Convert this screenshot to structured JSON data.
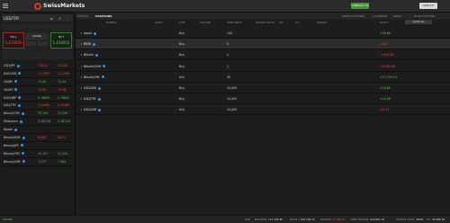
{
  "brand": {
    "name": "SwissMarkets"
  },
  "header": {
    "contact_label": "CONTACT US",
    "deposit_label": "DEPOSIT"
  },
  "symbol": {
    "name": "USD/TRY",
    "icons": "⇄ ↗ ⋮"
  },
  "trade": {
    "sell_label": "SELL",
    "sell_price": "5.434689",
    "buy_label": "BUY",
    "buy_price": "5.434952",
    "quantity": "10,000"
  },
  "watchlist": [
    {
      "name": "USD/JPY",
      "bid": "110.61",
      "ask": "110.62",
      "dir": "dn"
    },
    {
      "name": "EUR/USD",
      "bid": "1.17797",
      "ask": "1.17799",
      "dir": "dn"
    },
    {
      "name": "Oil/BR",
      "bid": "72.40",
      "ask": "72.44",
      "dir": "up"
    },
    {
      "name": "Oil/WT",
      "bid": "70.55",
      "ask": "70.58",
      "dir": "dn"
    },
    {
      "name": "EUR/GBP",
      "bid": "0.76849",
      "ask": "0.76852",
      "dir": "up"
    },
    {
      "name": "USD/TRY",
      "bid": "5.43469",
      "ask": "5.43495",
      "dir": "dn"
    },
    {
      "name": "Bitcoin/TRY",
      "bid": "47,195",
      "ask": "47,235",
      "dir": "up"
    },
    {
      "name": "Ethereum",
      "bid": "3,163.58",
      "ask": "3,167.93",
      "dir": "up"
    },
    {
      "name": "Ripple",
      "bid": "",
      "ask": "",
      "dir": "none"
    },
    {
      "name": "Bitcoin/EUR",
      "bid": "8,462",
      "ask": "8,472",
      "dir": "dn"
    },
    {
      "name": "Bitcoin/JPY",
      "bid": "",
      "ask": "",
      "dir": "none"
    },
    {
      "name": "Bitcoin/TRY",
      "bid": "47,191",
      "ask": "47,231",
      "dir": "up"
    },
    {
      "name": "Bitcoin/GBP",
      "bid": "7,577",
      "ask": "7,583",
      "dir": "up"
    }
  ],
  "tabs": [
    "CHARTS",
    "POSITIONS",
    "OPEN POSITIONS",
    "CALENDAR",
    "NEWS",
    "NOTIFICATIONS"
  ],
  "columns": [
    "SYMBOL",
    "ASSET",
    "TYPE",
    "VOLUME",
    "OPEN PRICE",
    "MARKET PRICE",
    "T/P",
    "S/L",
    "MARGIN",
    "PROFIT"
  ],
  "close_all_label": "CLOSE ALL",
  "positions": [
    {
      "instrument": "Apple",
      "direction": "Buy",
      "volume": "100",
      "profit": "+56.64",
      "pcls": "up",
      "sel": false
    },
    {
      "instrument": "BMW",
      "direction": "Buy",
      "volume": "5",
      "profit": "-2.01",
      "pcls": "dn",
      "sel": true
    },
    {
      "instrument": "Bitcoin",
      "direction": "Buy",
      "volume": "1",
      "profit": "-1,986.35",
      "pcls": "dn",
      "sel": false
    },
    {
      "instrument": "Bitcoin/CNH",
      "direction": "Buy",
      "volume": "1",
      "profit": "-12,832.69",
      "pcls": "dn",
      "sel": false
    },
    {
      "instrument": "Bitcoin/TRY",
      "direction": "Sell",
      "volume": "30",
      "profit": "+57,729.74",
      "pcls": "up",
      "sel": false
    },
    {
      "instrument": "USD/SEK",
      "direction": "Buy",
      "volume": "10,000",
      "profit": "+34.65",
      "pcls": "up",
      "sel": false
    },
    {
      "instrument": "USD/TRY",
      "direction": "Buy",
      "volume": "10,000",
      "profit": "+24.49",
      "pcls": "up",
      "sel": false
    },
    {
      "instrument": "USD/ZAR",
      "direction": "Sell",
      "volume": "10,000",
      "profit": "-43.74",
      "pcls": "dn",
      "sel": false
    }
  ],
  "status": {
    "connection": "ONLINE",
    "usd_label": "USD",
    "balance_label": "BALANCE:",
    "balance": "177,134.95",
    "equity_label": "EQUITY:",
    "equity": "222,720.15",
    "margin_label": "MARGIN:",
    "margin": "51,668.91",
    "free_margin_label": "FREE MARGIN:",
    "free_margin": "212,951.76",
    "margin_level_label": "MARGIN LEVEL:",
    "margin_level": "489%",
    "pl_label": "P/L:",
    "pl": "45,585.20"
  }
}
